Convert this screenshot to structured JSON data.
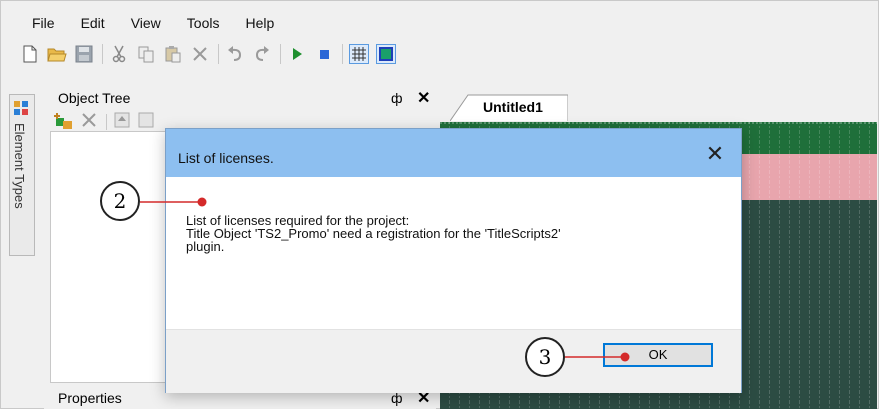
{
  "menu": [
    "File",
    "Edit",
    "View",
    "Tools",
    "Help"
  ],
  "toolbar_icons": [
    "new-file-icon",
    "open-folder-icon",
    "save-icon",
    "cut-icon",
    "copy-icon",
    "paste-icon",
    "delete-icon",
    "undo-icon",
    "redo-icon",
    "play-icon",
    "stop-icon",
    "grid-icon",
    "frame-icon"
  ],
  "side_tab": {
    "label": "Element Types"
  },
  "object_tree": {
    "title": "Object Tree",
    "pin": "ф",
    "close": "✕"
  },
  "properties": {
    "title": "Properties",
    "pin": "ф",
    "close": "✕"
  },
  "document": {
    "tab_label": "Untitled1"
  },
  "dialog": {
    "title": "List of licenses.",
    "close": "✕",
    "line1": "List of licenses required for the project:",
    "line2": "Title Object 'TS2_Promo' need a registration for the 'TitleScripts2'",
    "line3": "plugin.",
    "ok_label": "OK"
  },
  "callouts": [
    "2",
    "3"
  ],
  "colors": {
    "title_bar": "#8dbff0",
    "canvas_green": "#1f6f3a",
    "canvas_pink": "#e8a5ad",
    "canvas_teal": "#2c4c43",
    "callout_red": "#d42a2a",
    "accent_blue": "#0078d7"
  }
}
